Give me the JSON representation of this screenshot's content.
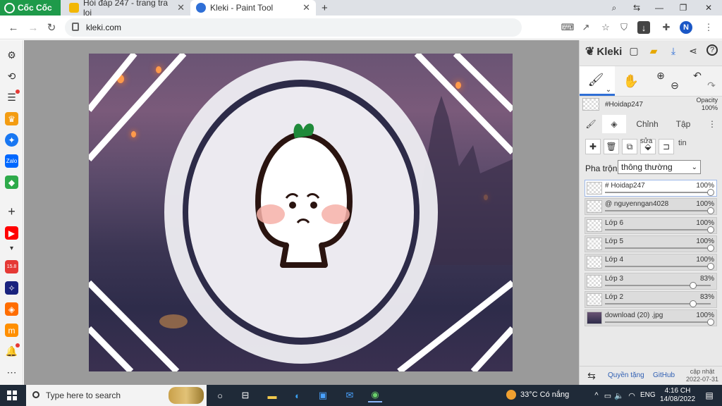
{
  "browser": {
    "brand": "Cốc Cốc",
    "tabs": [
      {
        "title": "Hỏi đáp 247 - trang tra loi",
        "active": false
      },
      {
        "title": "Kleki - Paint Tool",
        "active": true
      }
    ],
    "new_tab": "+",
    "url": "kleki.com",
    "profile_initial": "N"
  },
  "kleki": {
    "title": "Kleki",
    "top_layer_name": "#Hoidap247",
    "opacity_label": "Opacity",
    "opacity_value": "100%",
    "tabs": [
      "Chỉnh",
      "Tập"
    ],
    "tab_tin": "tin",
    "layer_buttons_label": "sửa",
    "blend_label": "Pha trộn",
    "blend_value": "thông thường",
    "layers": [
      {
        "name": "# Hoidap247",
        "opacity": "100%",
        "value": 1.0,
        "selected": true
      },
      {
        "name": "@ nguyenngan4028",
        "opacity": "100%",
        "value": 1.0,
        "selected": false
      },
      {
        "name": "Lớp 6",
        "opacity": "100%",
        "value": 1.0,
        "selected": false
      },
      {
        "name": "Lớp 5",
        "opacity": "100%",
        "value": 1.0,
        "selected": false
      },
      {
        "name": "Lớp 4",
        "opacity": "100%",
        "value": 1.0,
        "selected": false
      },
      {
        "name": "Lớp 3",
        "opacity": "83%",
        "value": 0.83,
        "selected": false
      },
      {
        "name": "Lớp 2",
        "opacity": "83%",
        "value": 0.83,
        "selected": false
      },
      {
        "name": "download (20) .jpg",
        "opacity": "100%",
        "value": 1.0,
        "selected": false
      }
    ],
    "bottom": {
      "privacy": "Quyền tặng",
      "github": "GitHub",
      "update_label": "cập nhật",
      "update_date": "2022-07-31"
    }
  },
  "taskbar": {
    "search_placeholder": "Type here to search",
    "weather": "33°C Có nắng",
    "language": "ENG",
    "time": "4:16 CH",
    "date": "14/08/2022"
  },
  "colors": {
    "brand_green": "#1e9a4a",
    "accent_blue": "#2f6fd6",
    "taskbar": "#1f2a38"
  }
}
